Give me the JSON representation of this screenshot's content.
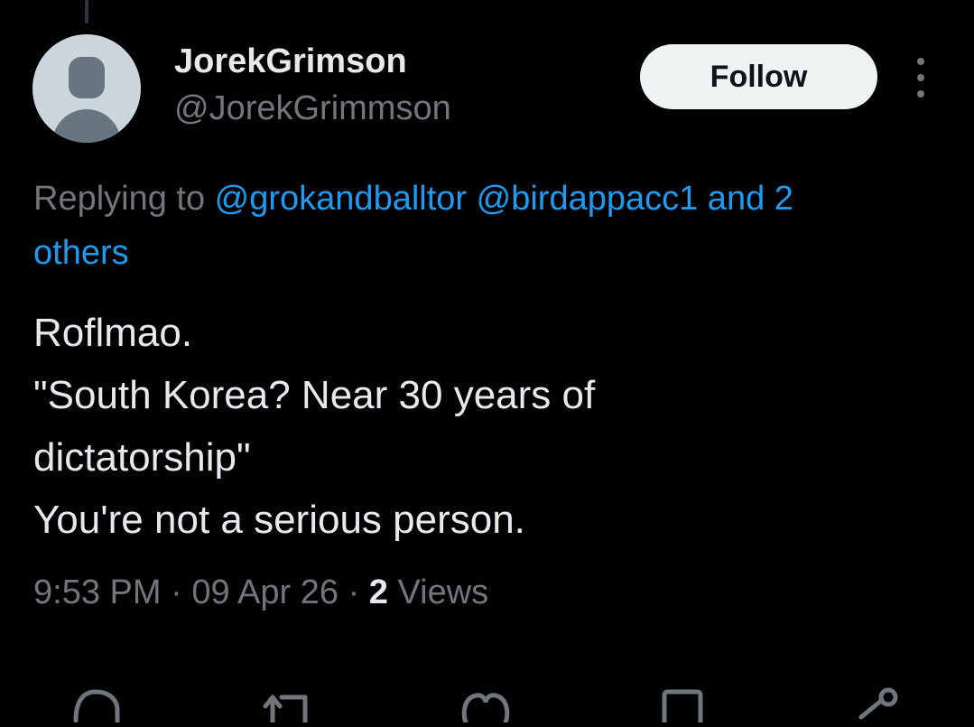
{
  "author": {
    "display_name": "JorekGrimson",
    "handle": "@JorekGrimmson"
  },
  "follow_label": "Follow",
  "reply_context": {
    "prefix": "Replying to ",
    "mentions": [
      "@grokandballtor",
      "@birdappacc1"
    ],
    "and": " and 2",
    "others": "others"
  },
  "tweet": {
    "lines": [
      "Roflmao.",
      "\"South Korea? Near 30 years of",
      "dictatorship\"",
      "You're not a serious person."
    ]
  },
  "meta": {
    "time": "9:53 PM",
    "separator": "·",
    "date": "09 Apr 26",
    "views_count": "2",
    "views_label": "Views"
  },
  "icons": {
    "more": "more-vertical-icon",
    "reply": "reply-icon",
    "retweet": "retweet-icon",
    "like": "heart-icon",
    "bookmark": "bookmark-icon",
    "share": "share-icon"
  },
  "colors": {
    "background": "#000000",
    "text": "#e7e9ea",
    "secondary": "#71767b",
    "link": "#1d9bf0",
    "button_bg": "#eff3f4"
  }
}
